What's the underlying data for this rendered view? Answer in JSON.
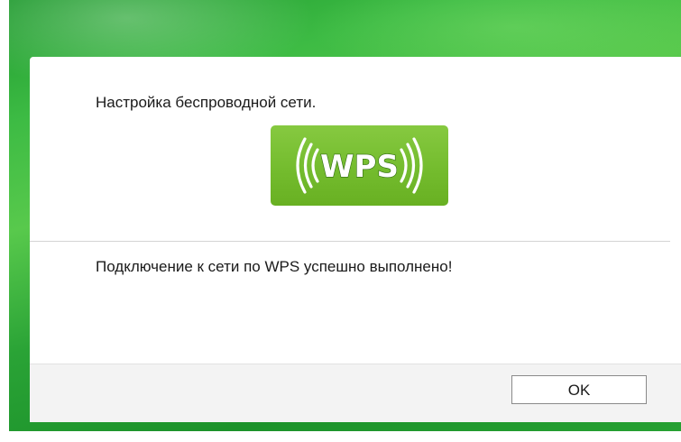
{
  "dialog": {
    "heading": "Настройка беспроводной сети.",
    "logo": {
      "text": "WPS",
      "icon": "wps-logo-icon",
      "background_color": "#76bd31",
      "text_color": "#ffffff"
    },
    "message": "Подключение к сети по WPS успешно выполнено!",
    "ok_label": "OK"
  },
  "colors": {
    "frame_green": "#2aa336",
    "accent_green": "#76bd31"
  }
}
